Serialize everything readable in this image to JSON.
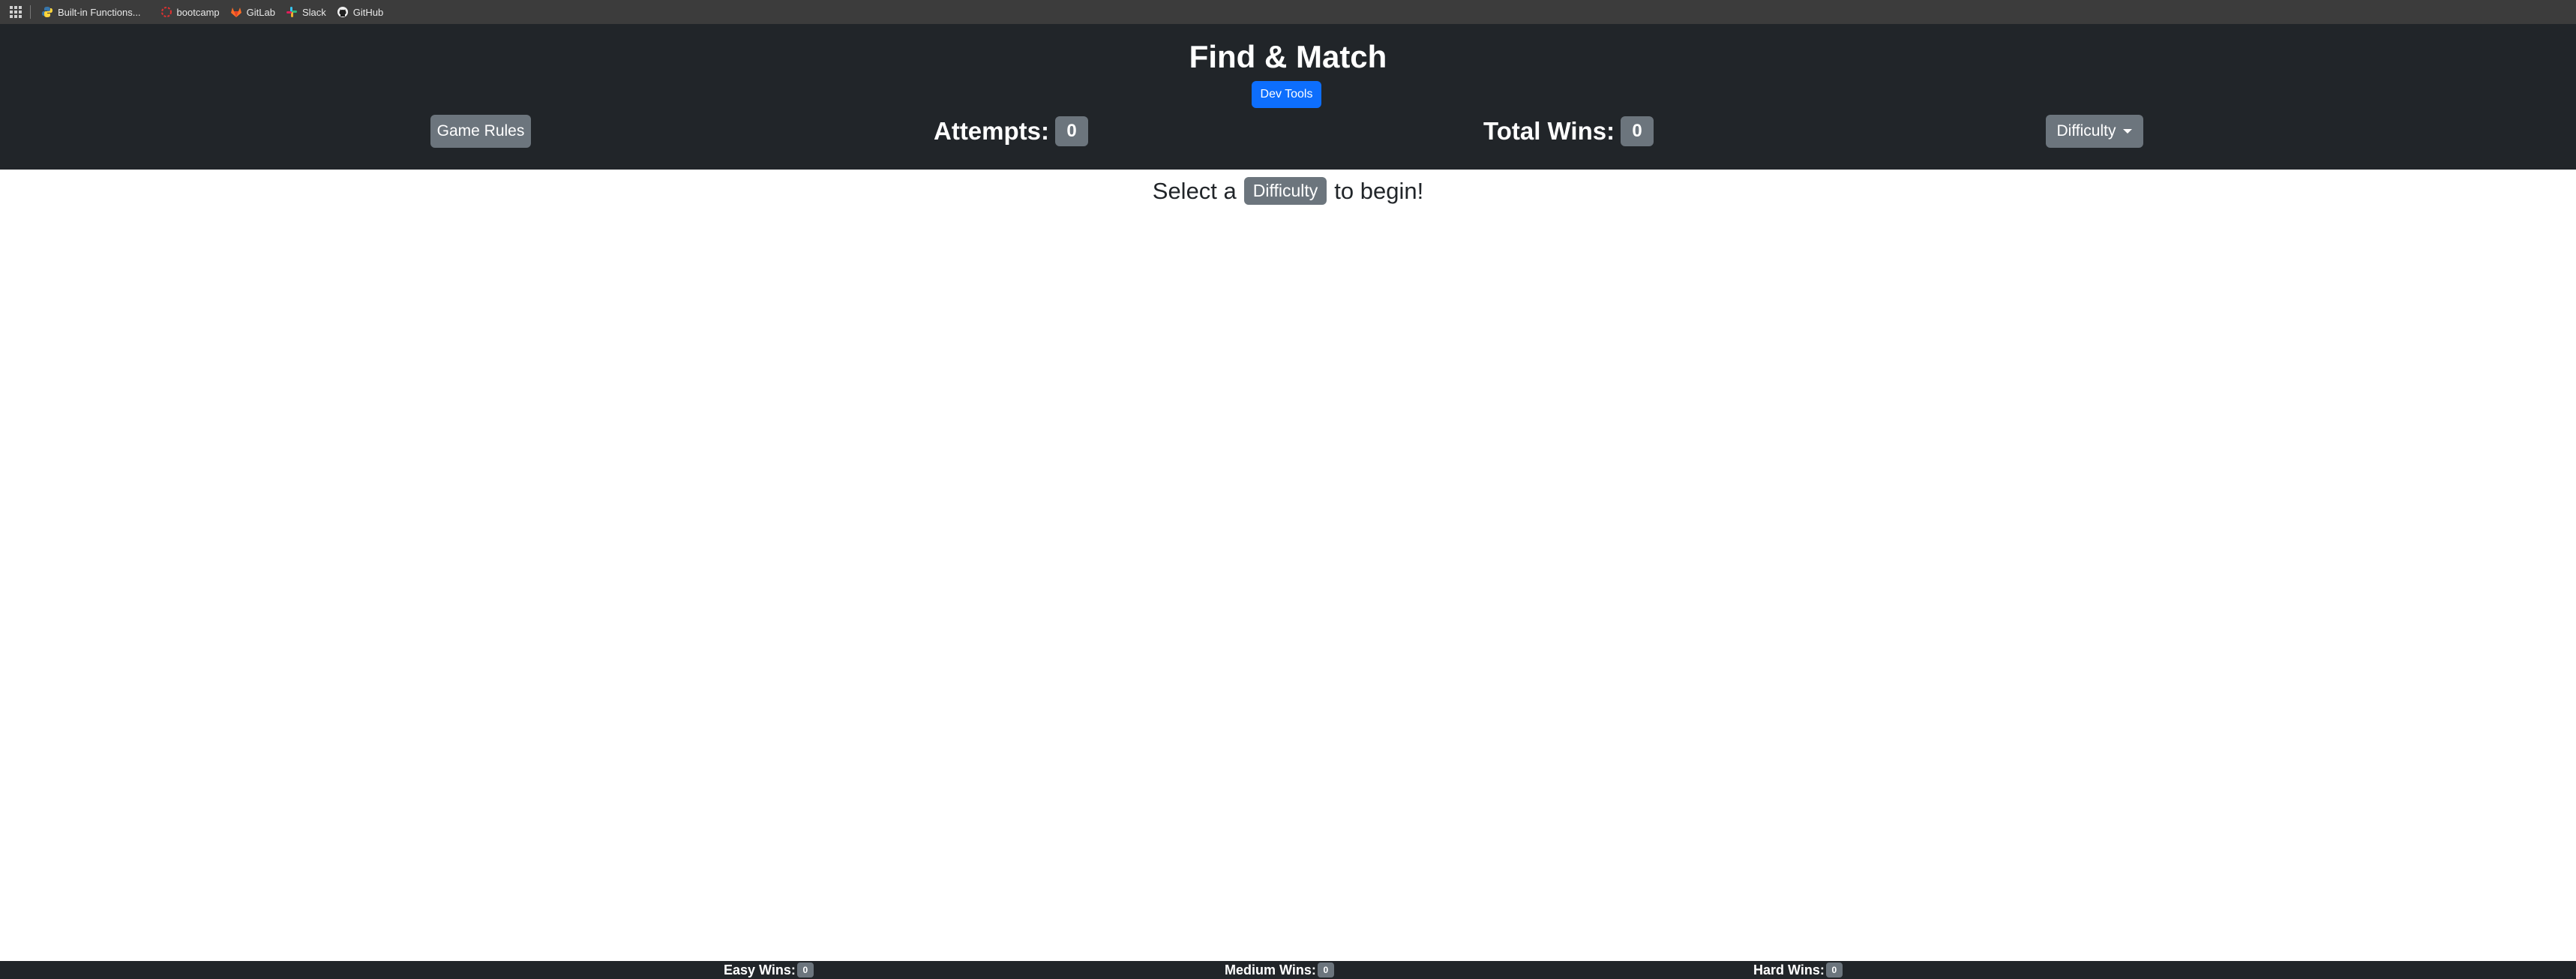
{
  "bookmarks": {
    "items": [
      {
        "label": "Built-in Functions...",
        "icon": "python-icon"
      },
      {
        "label": "bootcamp",
        "icon": "bootcamp-icon"
      },
      {
        "label": "GitLab",
        "icon": "gitlab-icon"
      },
      {
        "label": "Slack",
        "icon": "slack-icon"
      },
      {
        "label": "GitHub",
        "icon": "github-icon"
      }
    ]
  },
  "header": {
    "title": "Find & Match",
    "dev_tools_label": "Dev Tools",
    "rules_label": "Game Rules",
    "attempts_label": "Attempts:",
    "attempts_value": "0",
    "total_wins_label": "Total Wins:",
    "total_wins_value": "0",
    "difficulty_label": "Difficulty"
  },
  "main": {
    "prompt_before": "Select a",
    "prompt_badge": "Difficulty",
    "prompt_after": "to begin!"
  },
  "footer": {
    "easy_label": "Easy Wins:",
    "easy_value": "0",
    "medium_label": "Medium Wins:",
    "medium_value": "0",
    "hard_label": "Hard Wins:",
    "hard_value": "0"
  },
  "colors": {
    "header_bg": "#212529",
    "primary": "#0d6efd",
    "secondary": "#6c757d",
    "bookmarks_bg": "#3c3c3c"
  }
}
